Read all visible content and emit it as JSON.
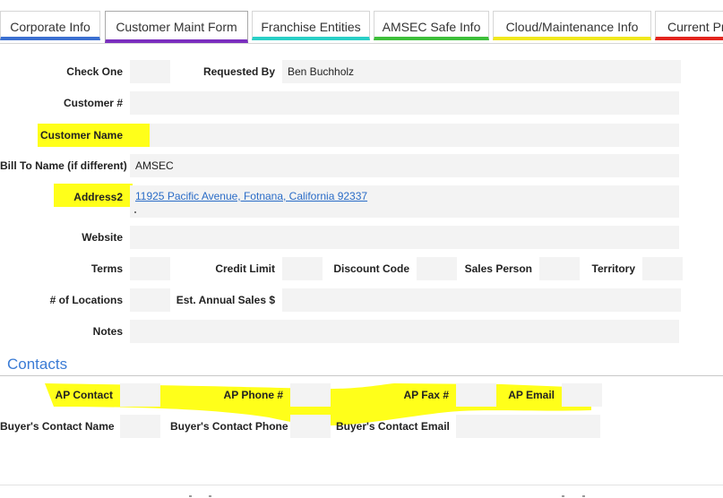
{
  "tabs": [
    {
      "label": "Corporate Info",
      "color": "#3b6fd0"
    },
    {
      "label": "Customer Maint Form",
      "color": "#7b2fbf"
    },
    {
      "label": "Franchise Entities",
      "color": "#29cfc6"
    },
    {
      "label": "AMSEC Safe Info",
      "color": "#3dbf3a"
    },
    {
      "label": "Cloud/Maintenance Info",
      "color": "#f0e81c"
    },
    {
      "label": "Current Pr",
      "color": "#e3241d"
    }
  ],
  "form": {
    "check_one_label": "Check One",
    "requested_by_label": "Requested By",
    "requested_by_value": "Ben Buchholz",
    "customer_num_label": "Customer #",
    "customer_name_label": "Customer Name",
    "bill_to_label": "Bill To Name (if different)",
    "bill_to_value": "AMSEC",
    "address2_label": "Address2",
    "address2_value": "11925 Pacific Avenue, Fotnana, California 92337",
    "website_label": "Website",
    "terms_label": "Terms",
    "credit_limit_label": "Credit Limit",
    "discount_code_label": "Discount Code",
    "sales_person_label": "Sales Person",
    "territory_label": "Territory",
    "locations_label": "# of Locations",
    "annual_sales_label": "Est. Annual Sales $",
    "notes_label": "Notes"
  },
  "contacts": {
    "title": "Contacts",
    "ap_contact_label": "AP Contact",
    "ap_phone_label": "AP Phone #",
    "ap_fax_label": "AP Fax #",
    "ap_email_label": "AP Email",
    "buyer_name_label": "Buyer's Contact Name",
    "buyer_phone_label": "Buyer's Contact Phone",
    "buyer_email_label": "Buyer's Contact Email"
  },
  "colors": {
    "highlight": "#ffff1a",
    "link": "#2a6cc7",
    "section": "#3a7bd5"
  }
}
